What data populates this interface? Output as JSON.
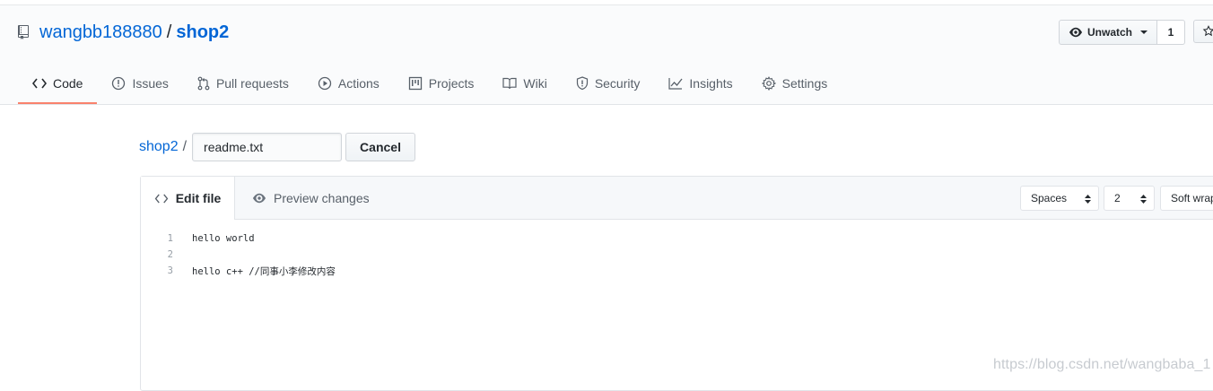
{
  "repo": {
    "owner": "wangbb188880",
    "separator": "/",
    "name": "shop2"
  },
  "watch": {
    "label": "Unwatch",
    "count": "1"
  },
  "tabs": [
    {
      "label": "Code",
      "icon": "code-icon",
      "selected": true
    },
    {
      "label": "Issues",
      "icon": "issue-icon"
    },
    {
      "label": "Pull requests",
      "icon": "pull-request-icon"
    },
    {
      "label": "Actions",
      "icon": "play-icon"
    },
    {
      "label": "Projects",
      "icon": "project-icon"
    },
    {
      "label": "Wiki",
      "icon": "book-icon"
    },
    {
      "label": "Security",
      "icon": "shield-icon"
    },
    {
      "label": "Insights",
      "icon": "graph-icon"
    },
    {
      "label": "Settings",
      "icon": "gear-icon"
    }
  ],
  "breadcrumb": {
    "repo": "shop2",
    "separator": "/"
  },
  "filename": {
    "value": "readme.txt"
  },
  "cancel_label": "Cancel",
  "editor": {
    "edit_tab": "Edit file",
    "preview_tab": "Preview changes",
    "indent_mode": "Spaces",
    "indent_size": "2",
    "wrap_mode": "Soft wrap"
  },
  "code_lines": [
    {
      "number": "1",
      "text": "hello world"
    },
    {
      "number": "2",
      "text": ""
    },
    {
      "number": "3",
      "text": "hello c++ //同事小李修改内容"
    }
  ],
  "watermark": "https://blog.csdn.net/wangbaba_1"
}
